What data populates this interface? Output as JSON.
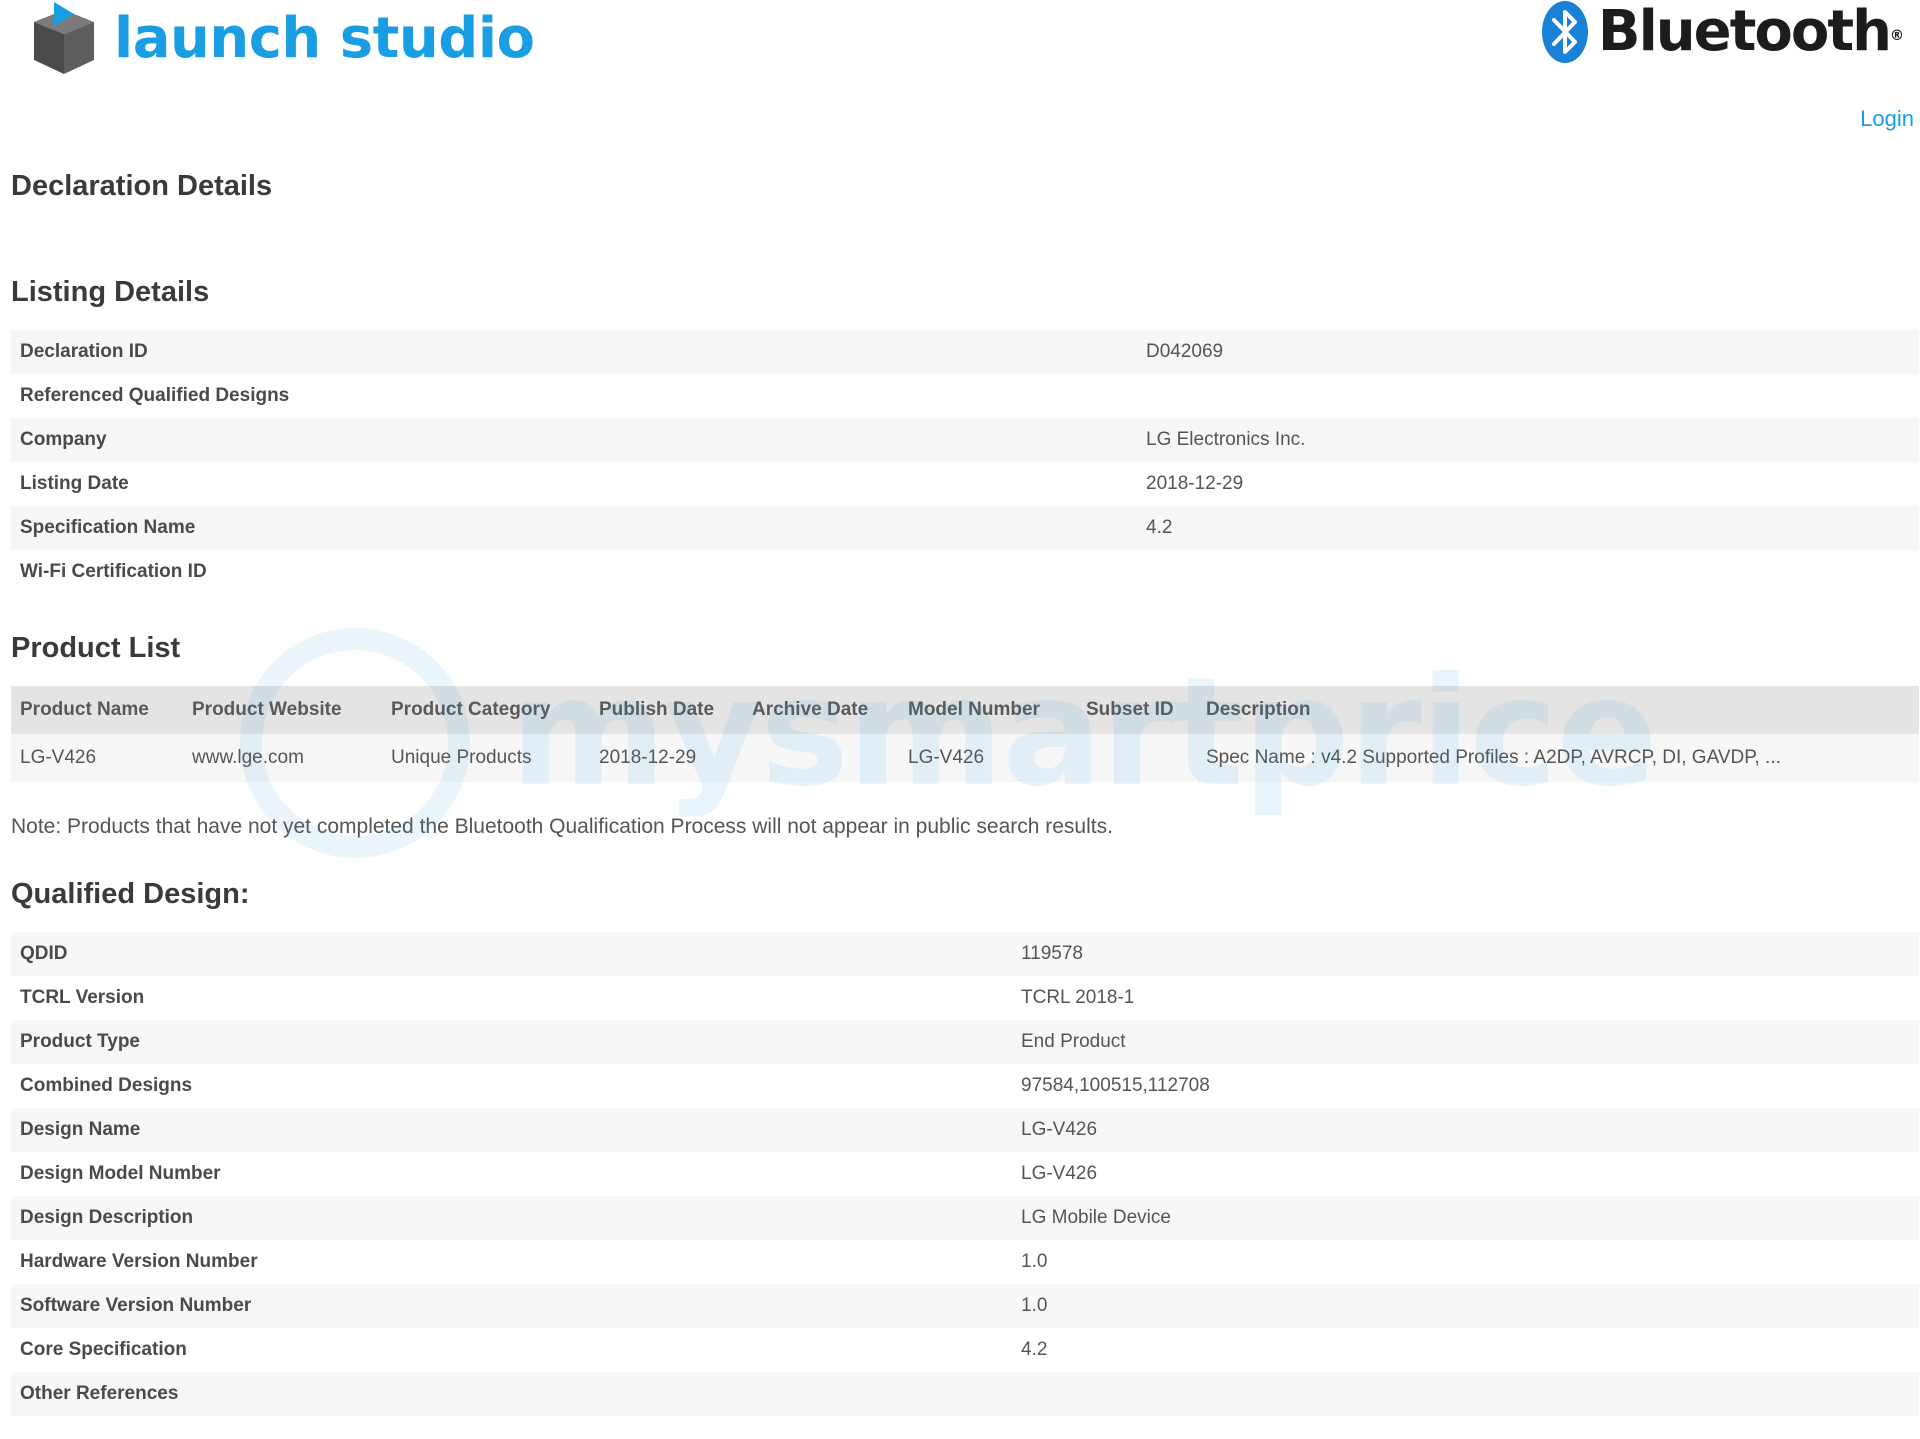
{
  "brand": {
    "name": "launch studio",
    "color": "#1a9ee3",
    "logo_icon": "cube-logo-icon"
  },
  "partner": {
    "name": "Bluetooth",
    "registered_mark": "®",
    "icon": "bluetooth-rune-icon"
  },
  "header": {
    "login_label": "Login"
  },
  "page_title": "Declaration Details",
  "listing": {
    "heading": "Listing Details",
    "rows": [
      {
        "label": "Declaration ID",
        "value": "D042069"
      },
      {
        "label": "Referenced Qualified Designs",
        "value": ""
      },
      {
        "label": "Company",
        "value": "LG Electronics Inc."
      },
      {
        "label": "Listing Date",
        "value": "2018-12-29"
      },
      {
        "label": "Specification Name",
        "value": "4.2"
      },
      {
        "label": "Wi-Fi Certification ID",
        "value": ""
      }
    ]
  },
  "products": {
    "heading": "Product List",
    "columns": [
      "Product Name",
      "Product Website",
      "Product Category",
      "Publish Date",
      "Archive Date",
      "Model Number",
      "Subset ID",
      "Description"
    ],
    "rows": [
      [
        "LG-V426",
        "www.lge.com",
        "Unique Products",
        "2018-12-29",
        "",
        "LG-V426",
        "",
        "Spec Name : v4.2 Supported Profiles : A2DP, AVRCP, DI, GAVDP, ..."
      ]
    ]
  },
  "note": "Note: Products that have not yet completed the Bluetooth Qualification Process will not appear in public search results.",
  "qualified": {
    "heading": "Qualified Design:",
    "rows": [
      {
        "label": "QDID",
        "value": "119578"
      },
      {
        "label": "TCRL Version",
        "value": "TCRL 2018-1"
      },
      {
        "label": "Product Type",
        "value": "End Product"
      },
      {
        "label": "Combined Designs",
        "value": "97584,100515,112708"
      },
      {
        "label": "Design Name",
        "value": "LG-V426"
      },
      {
        "label": "Design Model Number",
        "value": "LG-V426"
      },
      {
        "label": "Design Description",
        "value": "LG Mobile Device"
      },
      {
        "label": "Hardware Version Number",
        "value": "1.0"
      },
      {
        "label": "Software Version Number",
        "value": "1.0"
      },
      {
        "label": "Core Specification",
        "value": "4.2"
      },
      {
        "label": "Other References",
        "value": ""
      }
    ]
  },
  "watermark": {
    "text": "mysmartprice"
  }
}
